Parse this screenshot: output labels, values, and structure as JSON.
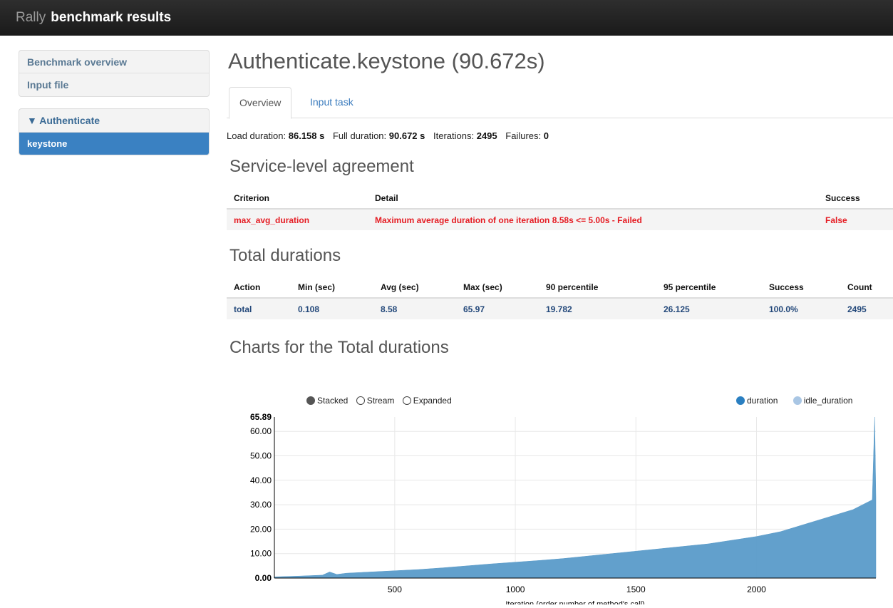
{
  "header": {
    "brand_light": "Rally",
    "brand_bold": "benchmark results"
  },
  "sidebar": {
    "top_items": [
      {
        "label": "Benchmark overview"
      },
      {
        "label": "Input file"
      }
    ],
    "group": {
      "label": "▼ Authenticate",
      "items": [
        {
          "label": "keystone",
          "active": true
        }
      ]
    }
  },
  "main": {
    "title": "Authenticate.keystone (90.672s)",
    "tabs": [
      {
        "label": "Overview",
        "active": true
      },
      {
        "label": "Input task",
        "active": false
      }
    ],
    "summary": {
      "load_label": "Load duration:",
      "load_value": "86.158 s",
      "full_label": "Full duration:",
      "full_value": "90.672 s",
      "iter_label": "Iterations:",
      "iter_value": "2495",
      "fail_label": "Failures:",
      "fail_value": "0"
    },
    "sla": {
      "heading": "Service-level agreement",
      "columns": [
        "Criterion",
        "Detail",
        "Success"
      ],
      "rows": [
        {
          "criterion": "max_avg_duration",
          "detail": "Maximum average duration of one iteration 8.58s <= 5.00s - Failed",
          "success": "False"
        }
      ]
    },
    "durations": {
      "heading": "Total durations",
      "columns": [
        "Action",
        "Min (sec)",
        "Avg (sec)",
        "Max (sec)",
        "90 percentile",
        "95 percentile",
        "Success",
        "Count"
      ],
      "rows": [
        {
          "action": "total",
          "min": "0.108",
          "avg": "8.58",
          "max": "65.97",
          "p90": "19.782",
          "p95": "26.125",
          "success": "100.0%",
          "count": "2495"
        }
      ]
    },
    "charts_heading": "Charts for the Total durations"
  },
  "chart_controls": {
    "modes": [
      "Stacked",
      "Stream",
      "Expanded"
    ],
    "selected_mode": "Stacked"
  },
  "colors": {
    "duration": "#5a9bc9",
    "idle_duration": "#a9c6e4",
    "sla_fail": "#e51c23",
    "value_blue": "#23487a",
    "active_nav": "#3a81c2"
  },
  "chart_data": {
    "type": "area",
    "xlabel": "Iteration (order number of method's call)",
    "ylabel": "",
    "xlim": [
      1,
      2495
    ],
    "ylim": [
      0,
      65.89
    ],
    "y_max_label": "65.89",
    "x_ticks": [
      500,
      1000,
      1500,
      2000
    ],
    "y_ticks": [
      "0.00",
      "10.00",
      "20.00",
      "30.00",
      "40.00",
      "50.00",
      "60.00"
    ],
    "legend": [
      "duration",
      "idle_duration"
    ],
    "series": [
      {
        "name": "duration",
        "x": [
          1,
          100,
          200,
          230,
          260,
          300,
          400,
          500,
          600,
          700,
          800,
          900,
          1000,
          1100,
          1200,
          1300,
          1400,
          1500,
          1600,
          1700,
          1800,
          1900,
          2000,
          2100,
          2200,
          2300,
          2400,
          2480,
          2490,
          2495
        ],
        "values": [
          0.5,
          0.8,
          1.2,
          2.5,
          1.5,
          2.0,
          2.5,
          3.0,
          3.5,
          4.2,
          5.0,
          5.8,
          6.5,
          7.2,
          8.0,
          9.0,
          10.0,
          11.0,
          12.0,
          13.0,
          14.0,
          15.5,
          17.0,
          19.0,
          22.0,
          25.0,
          28.0,
          32.0,
          65.89,
          33.0
        ]
      },
      {
        "name": "idle_duration",
        "x": [
          1,
          2495
        ],
        "values": [
          0,
          0
        ]
      }
    ]
  }
}
